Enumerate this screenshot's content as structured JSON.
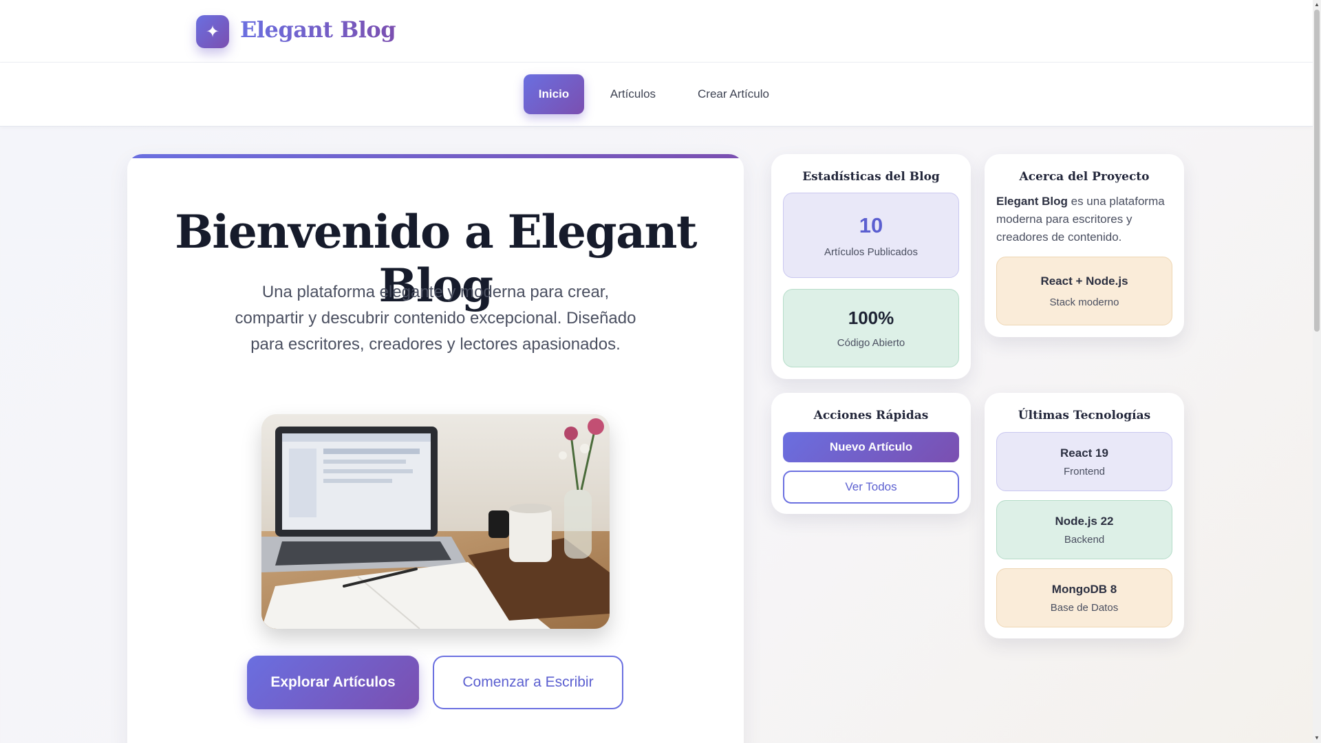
{
  "header": {
    "logo_icon": "sparkle-icon",
    "logo_glyph": "✦",
    "brand": "Elegant Blog"
  },
  "nav": {
    "items": [
      {
        "label": "Inicio",
        "active": true
      },
      {
        "label": "Artículos",
        "active": false
      },
      {
        "label": "Crear Artículo",
        "active": false
      }
    ]
  },
  "hero": {
    "title": "Bienvenido a Elegant Blog",
    "subtitle": "Una plataforma elegante y moderna para crear, compartir y descubrir contenido excepcional. Diseñado para escritores, creadores y lectores apasionados.",
    "explore_label": "Explorar Artículos",
    "write_label": "Comenzar a Escribir"
  },
  "stats": {
    "title": "Estadísticas del Blog",
    "articles_value": "10",
    "articles_label": "Artículos Publicados",
    "open_value": "100%",
    "open_label": "Código Abierto"
  },
  "about": {
    "title": "Acerca del Proyecto",
    "brand_bold": "Elegant Blog",
    "text": " es una plataforma moderna para escritores y creadores de contenido.",
    "stack_head": "React + Node.js",
    "stack_sub": "Stack moderno"
  },
  "quick": {
    "title": "Acciones Rápidas",
    "new_label": "Nuevo Artículo",
    "all_label": "Ver Todos"
  },
  "tech": {
    "title": "Últimas Tecnologías",
    "items": [
      {
        "name": "React 19",
        "role": "Frontend"
      },
      {
        "name": "Node.js 22",
        "role": "Backend"
      },
      {
        "name": "MongoDB 8",
        "role": "Base de Datos"
      }
    ]
  },
  "colors": {
    "accent_start": "#6a6fe0",
    "accent_end": "#7b4fb0"
  }
}
